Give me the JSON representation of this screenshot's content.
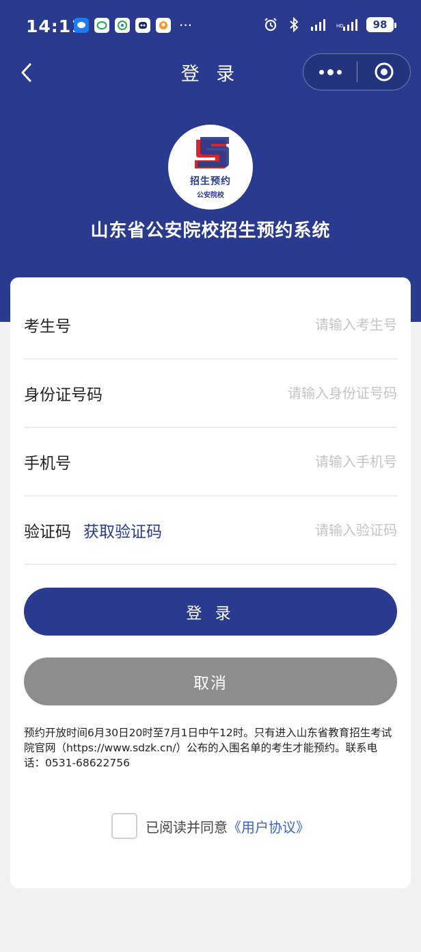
{
  "status_bar": {
    "time": "14:11",
    "more_indicator": "···",
    "battery": "98",
    "notification_icons": [
      "message-icon",
      "chat-icon",
      "mobile-app-icon",
      "bot-icon",
      "social-app-icon"
    ]
  },
  "nav": {
    "title": "登 录",
    "back_icon": "chevron-left-icon",
    "more_icon": "more-dots-icon",
    "close_icon": "target-icon"
  },
  "logo": {
    "line1": "招生预约",
    "line2": "公安院校"
  },
  "app_title": "山东省公安院校招生预约系统",
  "form": {
    "exam_no": {
      "label": "考生号",
      "placeholder": "请输入考生号",
      "value": ""
    },
    "id_no": {
      "label": "身份证号码",
      "placeholder": "请输入身份证号码",
      "value": ""
    },
    "phone": {
      "label": "手机号",
      "placeholder": "请输入手机号",
      "value": ""
    },
    "code": {
      "label": "验证码",
      "get_code": "获取验证码",
      "placeholder": "请输入验证码",
      "value": ""
    }
  },
  "buttons": {
    "login": "登 录",
    "cancel": "取消"
  },
  "notice": "预约开放时间6月30日20时至7月1日中午12时。只有进入山东省教育招生考试院官网（https://www.sdzk.cn/）公布的入围名单的考生才能预约。联系电话：0531-68622756",
  "agreement": {
    "text": "已阅读并同意",
    "link": "《用户协议》",
    "checked": false
  },
  "colors": {
    "primary": "#2a3b8f",
    "cancel": "#8d8d8d",
    "link": "#3a63c8",
    "logo_red": "#d9252a"
  }
}
